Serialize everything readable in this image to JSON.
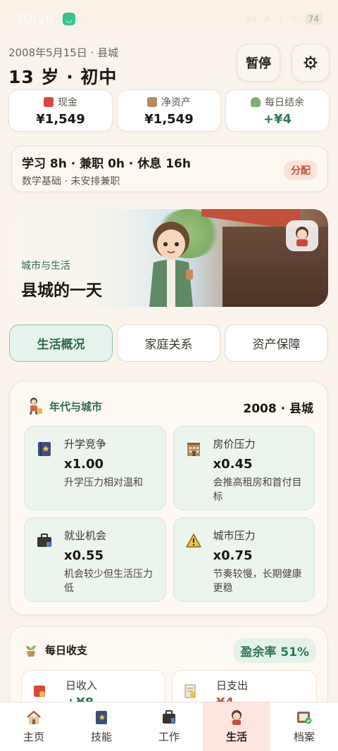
{
  "status_bar": {
    "time": "10:56",
    "battery": "74"
  },
  "header": {
    "date": "2008年5月15日",
    "place": "县城",
    "age_stage": "13 岁 · 初中",
    "pause_label": "暂停"
  },
  "stats": [
    {
      "label": "现金",
      "value": "¥1,549"
    },
    {
      "label": "净资产",
      "value": "¥1,549"
    },
    {
      "label": "每日结余",
      "value": "+¥4"
    }
  ],
  "schedule": {
    "main": "学习 8h · 兼职 0h · 休息 16h",
    "sub": "数学基础 · 未安排兼职",
    "assign_label": "分配"
  },
  "hero": {
    "subtitle": "城市与生活",
    "title": "县城的一天"
  },
  "tabs": [
    {
      "label": "生活概况",
      "active": true
    },
    {
      "label": "家庭关系",
      "active": false
    },
    {
      "label": "资产保障",
      "active": false
    }
  ],
  "era_card": {
    "title": "年代与城市",
    "year_city": "2008 · 县城",
    "items": [
      {
        "label": "升学竞争",
        "value": "x1.00",
        "desc": "升学压力相对温和",
        "icon": "book-icon"
      },
      {
        "label": "房价压力",
        "value": "x0.45",
        "desc": "会推高租房和首付目标",
        "icon": "building-icon"
      },
      {
        "label": "就业机会",
        "value": "x0.55",
        "desc": "机会较少但生活压力低",
        "icon": "briefcase-icon"
      },
      {
        "label": "城市压力",
        "value": "x0.75",
        "desc": "节奏较慢，长期健康更稳",
        "icon": "warning-icon"
      }
    ]
  },
  "daily": {
    "title": "每日收支",
    "surplus_rate": "盈余率 51%",
    "income": {
      "label": "日收入",
      "value": "+¥8"
    },
    "expense": {
      "label": "日支出",
      "value": "¥4"
    }
  },
  "nav": [
    {
      "label": "主页",
      "icon": "home-icon",
      "active": false
    },
    {
      "label": "技能",
      "icon": "skills-book-icon",
      "active": false
    },
    {
      "label": "工作",
      "icon": "work-bag-icon",
      "active": false
    },
    {
      "label": "生活",
      "icon": "life-avatar-icon",
      "active": true
    },
    {
      "label": "档案",
      "icon": "archive-icon",
      "active": false
    }
  ],
  "colors": {
    "accent_green": "#2f6a50",
    "positive": "#2f7a55",
    "alert": "#c0553a",
    "nav_active_bg": "#fde6df"
  }
}
